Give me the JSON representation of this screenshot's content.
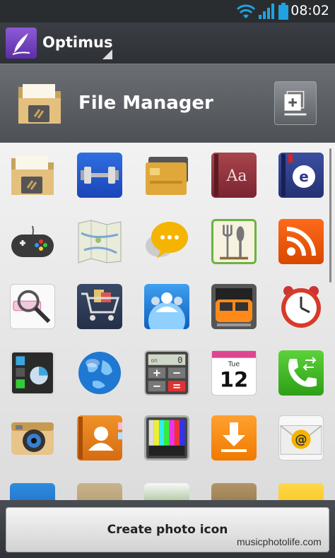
{
  "status_bar": {
    "time": "08:02"
  },
  "app_bar": {
    "title": "Optimus"
  },
  "header": {
    "title": "File Manager"
  },
  "bottom": {
    "create_label": "Create photo icon"
  },
  "watermark": {
    "text": "musicphotolife.com"
  },
  "icons": {
    "calendar_month": "Tue",
    "calendar_day": "12",
    "calculator_display": "0",
    "calculator_on": "on",
    "dictionary": "Aa",
    "ebook": "e"
  },
  "colors": {
    "status_bg": "#2a2d30",
    "wifi": "#1ea3e0",
    "accent_purple": "#6b3fbf",
    "grid_bg": "#e8e8e8"
  }
}
